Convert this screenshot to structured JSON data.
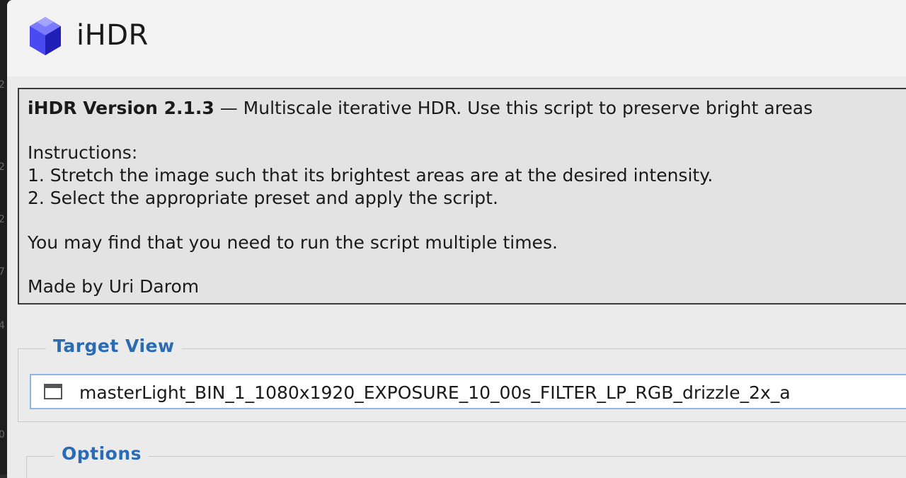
{
  "window": {
    "title": "iHDR",
    "icon": "blue-cube-icon"
  },
  "edge_fragments": [
    "2",
    "2",
    "2",
    "7",
    "4",
    "0"
  ],
  "info": {
    "heading": "iHDR Version 2.1.3",
    "heading_rest": " — Multiscale iterative HDR. Use this script to preserve bright areas",
    "instructions_label": "Instructions:",
    "step1": "1. Stretch the image such that its brightest areas are at the desired intensity.",
    "step2": "2. Select the appropriate preset and apply the script.",
    "note": "You may find that you need to run the script multiple times.",
    "credit": "Made by Uri Darom"
  },
  "target_view": {
    "label": "Target View",
    "icon": "window-icon",
    "selected_value": "masterLight_BIN_1_1080x1920_EXPOSURE_10_00s_FILTER_LP_RGB_drizzle_2x_a"
  },
  "options": {
    "label": "Options"
  },
  "colors": {
    "group_title": "#2b6bb3",
    "focus_border": "#8fb4e6"
  }
}
